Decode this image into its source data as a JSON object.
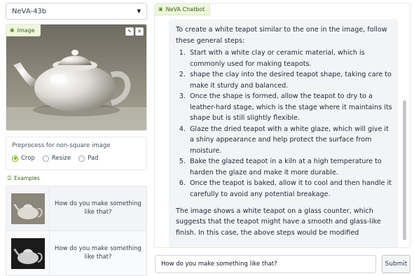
{
  "model_select": {
    "value": "NeVA-43b"
  },
  "image_panel": {
    "label": "Image",
    "label_icon": "image-icon",
    "tools": [
      {
        "icon": "pencil-icon",
        "glyph": "✎"
      },
      {
        "icon": "close-icon",
        "glyph": "✕"
      }
    ]
  },
  "preprocess": {
    "title": "Preprocess for non-square image",
    "options": [
      "Crop",
      "Resize",
      "Pad"
    ],
    "selected": "Crop"
  },
  "examples": {
    "label": "Examples",
    "label_icon": "list-icon",
    "rows": [
      {
        "text": "How do you make something like that?"
      },
      {
        "text": "How do you make something like that?"
      }
    ]
  },
  "chat": {
    "label": "NeVA Chatbot",
    "label_icon": "chat-icon",
    "intro": "To create a white teapot similar to the one in the image, follow these general steps:",
    "steps": [
      "Start with a white clay or ceramic material, which is commonly used for making teapots.",
      "shape the clay into the desired teapot shape, taking care to make it sturdy and balanced.",
      "Once the shape is formed, allow the teapot to dry to a leather-hard stage, which is the stage where it maintains its shape but is still slightly flexible.",
      "Glaze the dried teapot with a white glaze, which will give it a shiny appearance and help protect the surface from moisture.",
      "Bake the glazed teapot in a kiln at a high temperature to harden the glaze and make it more durable.",
      "Once the teapot is baked, allow it to cool and then handle it carefully to avoid any potential breakage."
    ],
    "outro": "The image shows a white teapot on a glass counter, which suggests that the teapot might have a smooth and glass-like finish. In this case, the above steps would be modified"
  },
  "input": {
    "value": "How do you make something like that?"
  },
  "submit_label": "Submit",
  "colors": {
    "accent": "#76b900",
    "label_bg": "#eef7dc"
  }
}
